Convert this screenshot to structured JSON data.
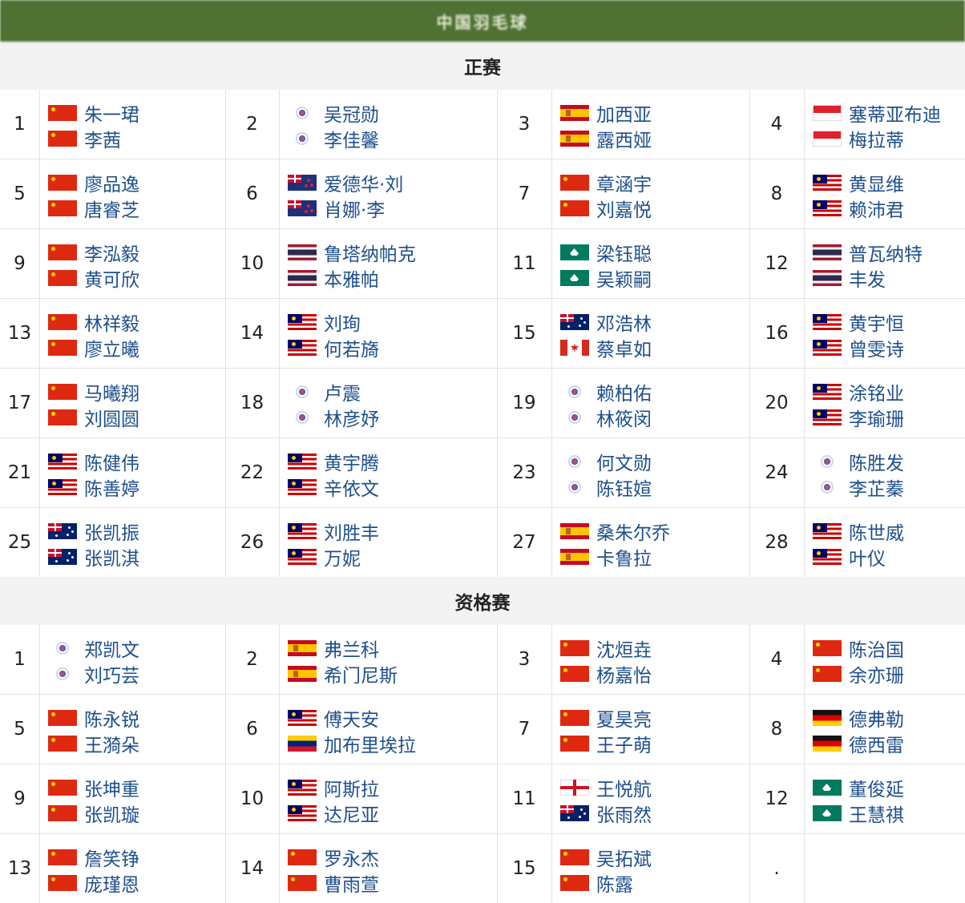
{
  "header": {
    "title": "中国羽毛球"
  },
  "sections": [
    {
      "title": "正赛",
      "entries": [
        {
          "seed": "1",
          "players": [
            {
              "name": "朱一珺",
              "flag": "cn"
            },
            {
              "name": "李茜",
              "flag": "cn"
            }
          ]
        },
        {
          "seed": "2",
          "players": [
            {
              "name": "吴冠勋",
              "flag": "tpe"
            },
            {
              "name": "李佳馨",
              "flag": "tpe"
            }
          ]
        },
        {
          "seed": "3",
          "players": [
            {
              "name": "加西亚",
              "flag": "es"
            },
            {
              "name": "露西娅",
              "flag": "es"
            }
          ]
        },
        {
          "seed": "4",
          "players": [
            {
              "name": "塞蒂亚布迪",
              "flag": "id"
            },
            {
              "name": "梅拉蒂",
              "flag": "id"
            }
          ]
        },
        {
          "seed": "5",
          "players": [
            {
              "name": "廖品逸",
              "flag": "cn"
            },
            {
              "name": "唐睿芝",
              "flag": "cn"
            }
          ]
        },
        {
          "seed": "6",
          "players": [
            {
              "name": "爱德华·刘",
              "flag": "nz"
            },
            {
              "name": "肖娜·李",
              "flag": "nz"
            }
          ]
        },
        {
          "seed": "7",
          "players": [
            {
              "name": "章涵宇",
              "flag": "cn"
            },
            {
              "name": "刘嘉悦",
              "flag": "cn"
            }
          ]
        },
        {
          "seed": "8",
          "players": [
            {
              "name": "黄显维",
              "flag": "my"
            },
            {
              "name": "赖沛君",
              "flag": "my"
            }
          ]
        },
        {
          "seed": "9",
          "players": [
            {
              "name": "李泓毅",
              "flag": "cn"
            },
            {
              "name": "黄可欣",
              "flag": "cn"
            }
          ]
        },
        {
          "seed": "10",
          "players": [
            {
              "name": "鲁塔纳帕克",
              "flag": "th"
            },
            {
              "name": "本雅帕",
              "flag": "th"
            }
          ]
        },
        {
          "seed": "11",
          "players": [
            {
              "name": "梁钰聪",
              "flag": "mo"
            },
            {
              "name": "吴颖嗣",
              "flag": "mo"
            }
          ]
        },
        {
          "seed": "12",
          "players": [
            {
              "name": "普瓦纳特",
              "flag": "th"
            },
            {
              "name": "丰发",
              "flag": "th"
            }
          ]
        },
        {
          "seed": "13",
          "players": [
            {
              "name": "林祥毅",
              "flag": "cn"
            },
            {
              "name": "廖立曦",
              "flag": "cn"
            }
          ]
        },
        {
          "seed": "14",
          "players": [
            {
              "name": "刘珣",
              "flag": "my"
            },
            {
              "name": "何若旖",
              "flag": "my"
            }
          ]
        },
        {
          "seed": "15",
          "players": [
            {
              "name": "邓浩林",
              "flag": "au"
            },
            {
              "name": "蔡卓如",
              "flag": "ca"
            }
          ]
        },
        {
          "seed": "16",
          "players": [
            {
              "name": "黄宇恒",
              "flag": "my"
            },
            {
              "name": "曾雯诗",
              "flag": "my"
            }
          ]
        },
        {
          "seed": "17",
          "players": [
            {
              "name": "马曦翔",
              "flag": "cn"
            },
            {
              "name": "刘圆圆",
              "flag": "cn"
            }
          ]
        },
        {
          "seed": "18",
          "players": [
            {
              "name": "卢震",
              "flag": "tpe"
            },
            {
              "name": "林彦妤",
              "flag": "tpe"
            }
          ]
        },
        {
          "seed": "19",
          "players": [
            {
              "name": "赖柏佑",
              "flag": "tpe"
            },
            {
              "name": "林筱闵",
              "flag": "tpe"
            }
          ]
        },
        {
          "seed": "20",
          "players": [
            {
              "name": "涂铭业",
              "flag": "my"
            },
            {
              "name": "李瑜珊",
              "flag": "my"
            }
          ]
        },
        {
          "seed": "21",
          "players": [
            {
              "name": "陈健伟",
              "flag": "my"
            },
            {
              "name": "陈善婷",
              "flag": "my"
            }
          ]
        },
        {
          "seed": "22",
          "players": [
            {
              "name": "黄宇腾",
              "flag": "my"
            },
            {
              "name": "辛依文",
              "flag": "my"
            }
          ]
        },
        {
          "seed": "23",
          "players": [
            {
              "name": "何文勋",
              "flag": "tpe"
            },
            {
              "name": "陈钰媗",
              "flag": "tpe"
            }
          ]
        },
        {
          "seed": "24",
          "players": [
            {
              "name": "陈胜发",
              "flag": "tpe"
            },
            {
              "name": "李芷蓁",
              "flag": "tpe"
            }
          ]
        },
        {
          "seed": "25",
          "players": [
            {
              "name": "张凯振",
              "flag": "au"
            },
            {
              "name": "张凯淇",
              "flag": "au"
            }
          ]
        },
        {
          "seed": "26",
          "players": [
            {
              "name": "刘胜丰",
              "flag": "my"
            },
            {
              "name": "万妮",
              "flag": "my"
            }
          ]
        },
        {
          "seed": "27",
          "players": [
            {
              "name": "桑朱尔乔",
              "flag": "es"
            },
            {
              "name": "卡鲁拉",
              "flag": "es"
            }
          ]
        },
        {
          "seed": "28",
          "players": [
            {
              "name": "陈世威",
              "flag": "my"
            },
            {
              "name": "叶仪",
              "flag": "my"
            }
          ]
        }
      ]
    },
    {
      "title": "资格赛",
      "entries": [
        {
          "seed": "1",
          "players": [
            {
              "name": "郑凯文",
              "flag": "tpe"
            },
            {
              "name": "刘巧芸",
              "flag": "tpe"
            }
          ]
        },
        {
          "seed": "2",
          "players": [
            {
              "name": "弗兰科",
              "flag": "es"
            },
            {
              "name": "希门尼斯",
              "flag": "es"
            }
          ]
        },
        {
          "seed": "3",
          "players": [
            {
              "name": "沈烜垚",
              "flag": "cn"
            },
            {
              "name": "杨嘉怡",
              "flag": "cn"
            }
          ]
        },
        {
          "seed": "4",
          "players": [
            {
              "name": "陈治国",
              "flag": "cn"
            },
            {
              "name": "余亦珊",
              "flag": "cn"
            }
          ]
        },
        {
          "seed": "5",
          "players": [
            {
              "name": "陈永锐",
              "flag": "cn"
            },
            {
              "name": "王漪朵",
              "flag": "cn"
            }
          ]
        },
        {
          "seed": "6",
          "players": [
            {
              "name": "傅天安",
              "flag": "my"
            },
            {
              "name": "加布里埃拉",
              "flag": "ve"
            }
          ]
        },
        {
          "seed": "7",
          "players": [
            {
              "name": "夏昊亮",
              "flag": "cn"
            },
            {
              "name": "王子萌",
              "flag": "cn"
            }
          ]
        },
        {
          "seed": "8",
          "players": [
            {
              "name": "德弗勒",
              "flag": "de"
            },
            {
              "name": "德西雷",
              "flag": "de"
            }
          ]
        },
        {
          "seed": "9",
          "players": [
            {
              "name": "张坤重",
              "flag": "cn"
            },
            {
              "name": "张凯璇",
              "flag": "cn"
            }
          ]
        },
        {
          "seed": "10",
          "players": [
            {
              "name": "阿斯拉",
              "flag": "my"
            },
            {
              "name": "达尼亚",
              "flag": "my"
            }
          ]
        },
        {
          "seed": "11",
          "players": [
            {
              "name": "王悦航",
              "flag": "en"
            },
            {
              "name": "张雨然",
              "flag": "au"
            }
          ]
        },
        {
          "seed": "12",
          "players": [
            {
              "name": "董俊延",
              "flag": "mo"
            },
            {
              "name": "王慧祺",
              "flag": "mo"
            }
          ]
        },
        {
          "seed": "13",
          "players": [
            {
              "name": "詹笑铮",
              "flag": "cn"
            },
            {
              "name": "庞瑾恩",
              "flag": "cn"
            }
          ]
        },
        {
          "seed": "14",
          "players": [
            {
              "name": "罗永杰",
              "flag": "cn"
            },
            {
              "name": "曹雨萱",
              "flag": "cn"
            }
          ]
        },
        {
          "seed": "15",
          "players": [
            {
              "name": "吴拓斌",
              "flag": "cn"
            },
            {
              "name": "陈露",
              "flag": "cn"
            }
          ]
        },
        {
          "seed": ".",
          "players": []
        }
      ]
    }
  ]
}
